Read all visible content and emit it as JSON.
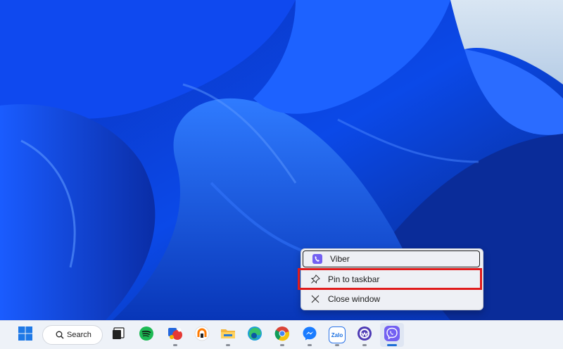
{
  "context_menu": {
    "app_label": "Viber",
    "items": [
      {
        "label": "Pin to taskbar",
        "icon": "pin-icon"
      },
      {
        "label": "Close window",
        "icon": "close-icon"
      }
    ]
  },
  "taskbar": {
    "search_label": "Search",
    "apps": [
      {
        "name": "start",
        "icon": "windows-logo-icon"
      },
      {
        "name": "task-view",
        "icon": "task-view-icon"
      },
      {
        "name": "spotify",
        "icon": "spotify-icon"
      },
      {
        "name": "app",
        "icon": "colorful-app-icon"
      },
      {
        "name": "orange-circle-app",
        "icon": "orange-ring-icon"
      },
      {
        "name": "file-explorer",
        "icon": "folder-icon"
      },
      {
        "name": "edge",
        "icon": "edge-icon"
      },
      {
        "name": "chrome",
        "icon": "chrome-icon"
      },
      {
        "name": "messenger",
        "icon": "messenger-icon"
      },
      {
        "name": "zalo",
        "icon": "zalo-icon",
        "text": "Zalo"
      },
      {
        "name": "other-app",
        "icon": "purple-ring-icon"
      },
      {
        "name": "viber",
        "icon": "viber-icon"
      }
    ]
  },
  "colors": {
    "highlight": "#e01b1b",
    "accent": "#1f6fd6",
    "viber": "#7360f2"
  }
}
